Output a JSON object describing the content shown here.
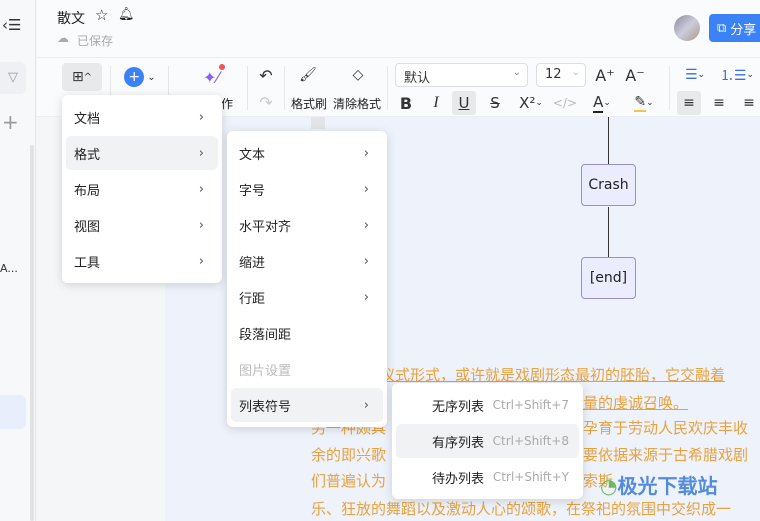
{
  "header": {
    "title": "散文",
    "saved": "已保存",
    "share": "分享"
  },
  "toolbar": {
    "ai_label": "作",
    "format_painter": "格式刷",
    "clear_format": "清除格式",
    "font": "默认",
    "size": "12"
  },
  "diagram": {
    "nodes": [
      "Crash",
      "[end]"
    ]
  },
  "document": {
    "lines": [
      "的仪式形式，或许就是戏剧形态最初的胚胎，它交融着",
      "量的虔诚召唤。",
      "另一种颇具",
      "孕育于劳动人民欢庆丰收",
      "余的即兴歌",
      "要依据来源于古希腊戏剧",
      "们普遍认为",
      "索斯",
      "乐、狂放的舞蹈以及激动人心的颂歌，在祭祀的氛围中交织成一"
    ]
  },
  "menu1": {
    "items": [
      "文档",
      "格式",
      "布局",
      "视图",
      "工具"
    ]
  },
  "menu2": {
    "items": [
      "文本",
      "字号",
      "水平对齐",
      "缩进",
      "行距",
      "段落间距",
      "图片设置",
      "列表符号"
    ]
  },
  "menu3": {
    "items": [
      {
        "label": "无序列表",
        "shortcut": "Ctrl+Shift+7"
      },
      {
        "label": "有序列表",
        "shortcut": "Ctrl+Shift+8"
      },
      {
        "label": "待办列表",
        "shortcut": "Ctrl+Shift+Y"
      }
    ]
  },
  "sidebar": {
    "truncated": "A..."
  },
  "watermark": "极光下载站",
  "colors": {
    "accent": "#3b82f6",
    "text_orange": "#e8a23f"
  }
}
